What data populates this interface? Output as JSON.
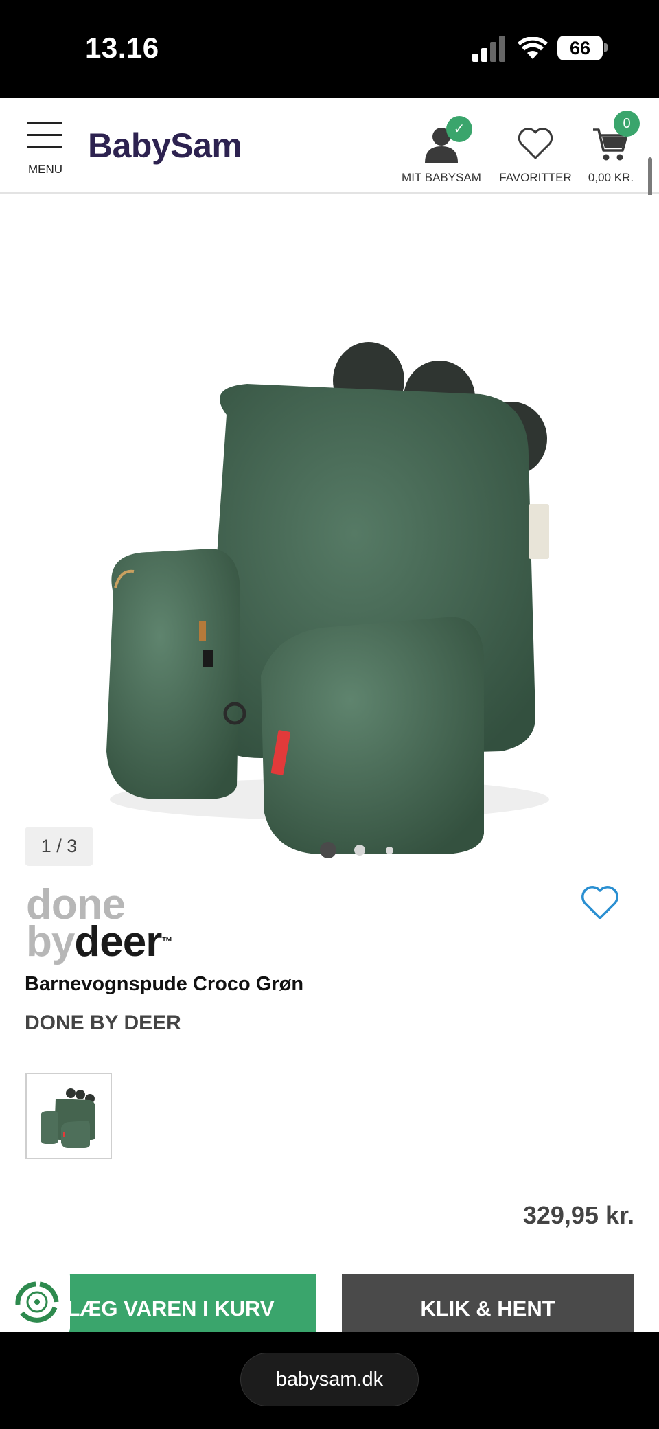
{
  "status_bar": {
    "time": "13.16",
    "battery": "66"
  },
  "header": {
    "menu_label": "MENU",
    "logo": "BabySam",
    "account_label": "MIT BABYSAM",
    "favorites_label": "FAVORITTER",
    "cart_total": "0,00 KR.",
    "cart_count": "0",
    "account_badge": "✓",
    "colors": {
      "brand": "#2d2250",
      "green": "#3aa56c"
    }
  },
  "gallery": {
    "counter": "1 / 3"
  },
  "product": {
    "brand_logo_line1": "done",
    "brand_logo_line2a": "by",
    "brand_logo_line2b": "deer",
    "brand_logo_tm": "™",
    "title": "Barnevognspude Croco Grøn",
    "brand": "DONE BY DEER",
    "price": "329,95 kr."
  },
  "actions": {
    "add_to_cart": "LÆG VAREN I KURV",
    "click_collect": "KLIK & HENT"
  },
  "browser": {
    "url": "babysam.dk"
  }
}
